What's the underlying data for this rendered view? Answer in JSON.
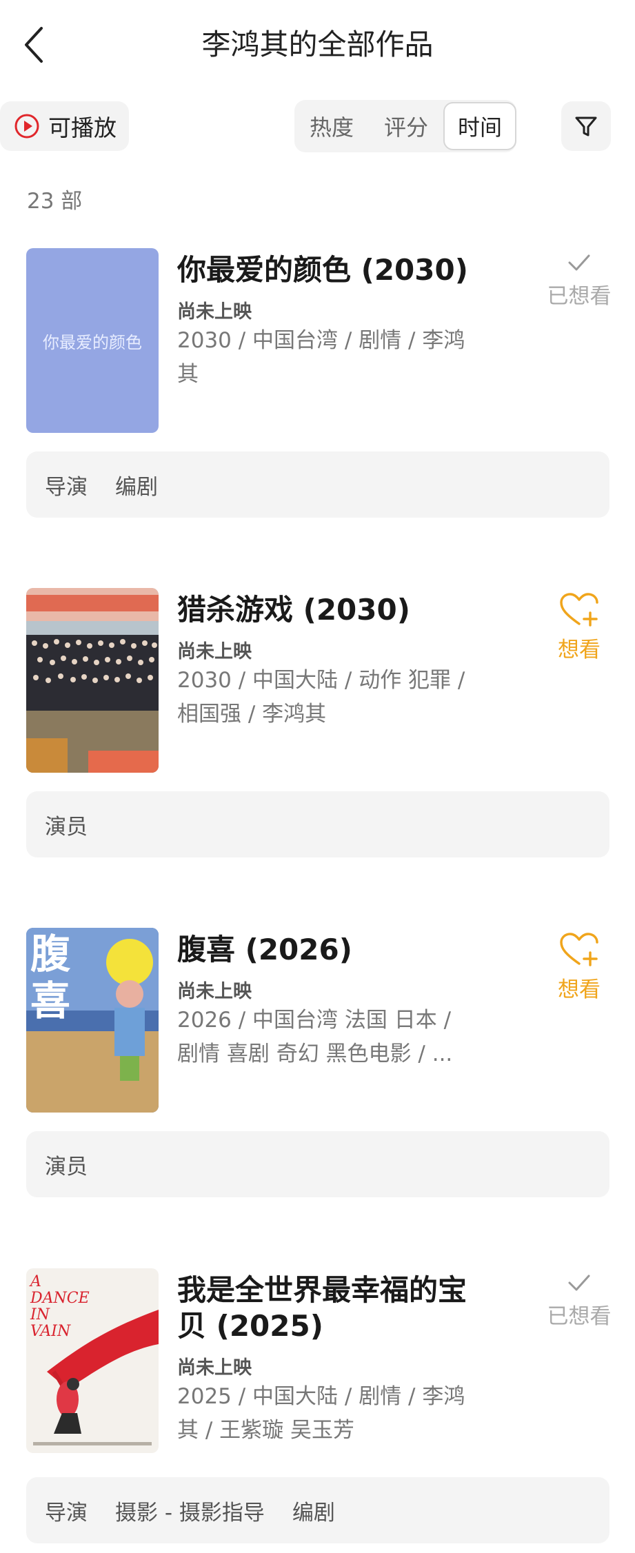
{
  "header": {
    "title": "李鸿其的全部作品"
  },
  "toolbar": {
    "playable_label": "可播放",
    "sort_tabs": [
      "热度",
      "评分",
      "时间"
    ],
    "active_sort": "时间"
  },
  "count_text": "23 部",
  "films": [
    {
      "title": "你最爱的颜色 (2030)",
      "poster_text": "你最爱的颜色",
      "status": "尚未上映",
      "meta_line1": "2030 / 中国台湾 / 剧情 / 李鸿",
      "meta_line2": "其",
      "want_label": "已想看",
      "want_icon": "check-icon",
      "roles": [
        "导演",
        "编剧"
      ]
    },
    {
      "title": "猎杀游戏 (2030)",
      "status": "尚未上映",
      "meta_line1": "2030 / 中国大陆 / 动作 犯罪 /",
      "meta_line2": "相国强 / 李鸿其",
      "want_label": "想看",
      "want_icon": "heart-plus-icon",
      "roles": [
        "演员"
      ]
    },
    {
      "title": "腹喜 (2026)",
      "poster_text": "腹喜",
      "status": "尚未上映",
      "meta_line1": "2026 / 中国台湾 法国 日本 /",
      "meta_line2": "剧情 喜剧 奇幻 黑色电影 / ...",
      "want_label": "想看",
      "want_icon": "heart-plus-icon",
      "roles": [
        "演员"
      ]
    },
    {
      "title": "我是全世界最幸福的宝贝 (2025)",
      "poster_text": "A DANCE IN VAIN",
      "status": "尚未上映",
      "meta_line1": "2025 / 中国大陆 / 剧情 / 李鸿",
      "meta_line2": "其 / 王紫璇 吴玉芳",
      "want_label": "已想看",
      "want_icon": "check-icon",
      "roles": [
        "导演",
        "摄影 - 摄影指导",
        "编剧"
      ]
    }
  ],
  "colors": {
    "accent_orange": "#f0a51c",
    "play_red": "#e0262b",
    "muted_gray": "#aaaaaa"
  }
}
